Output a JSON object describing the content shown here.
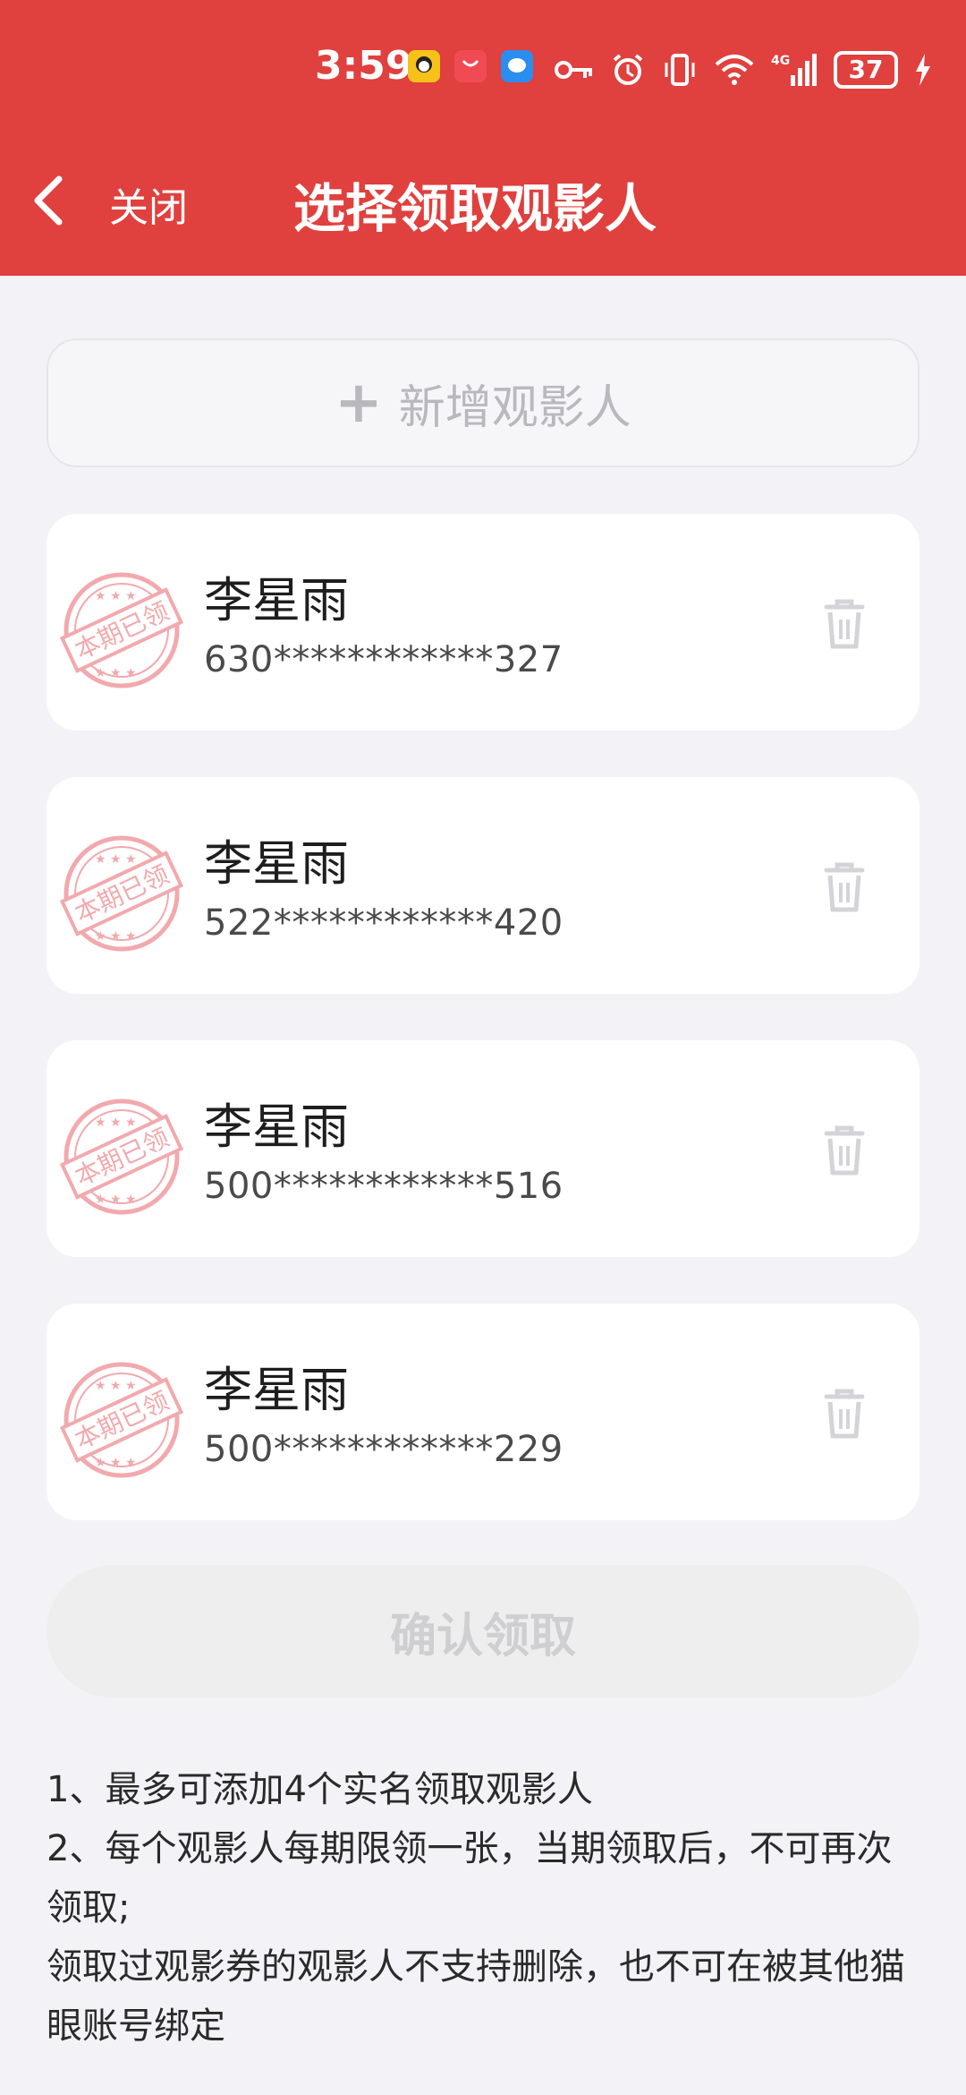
{
  "status_bar": {
    "time": "3:59",
    "battery": "37",
    "network": "4G",
    "app_icons": [
      "qq-icon",
      "huawei-appgallery-icon",
      "message-icon"
    ],
    "icons": [
      "key-icon",
      "alarm-icon",
      "vibrate-icon",
      "wifi-icon",
      "signal-icon",
      "battery-icon",
      "charging-icon"
    ]
  },
  "nav": {
    "back_icon": "chevron-left-icon",
    "close_label": "关闭",
    "title": "选择领取观影人"
  },
  "add_viewer": {
    "icon": "plus-icon",
    "label": "新增观影人"
  },
  "viewers": [
    {
      "name": "李星雨",
      "id": "630************327",
      "stamp": "本期已领"
    },
    {
      "name": "李星雨",
      "id": "522************420",
      "stamp": "本期已领"
    },
    {
      "name": "李星雨",
      "id": "500************516",
      "stamp": "本期已领"
    },
    {
      "name": "李星雨",
      "id": "500************229",
      "stamp": "本期已领"
    }
  ],
  "confirm_button": {
    "label": "确认领取",
    "enabled": false
  },
  "notes": [
    "1、最多可添加4个实名领取观影人",
    "2、每个观影人每期限领一张，当期领取后，不可再次领取;",
    "领取过观影券的观影人不支持删除，也不可在被其他猫眼账号绑定"
  ],
  "colors": {
    "header": "#e0403e",
    "background": "#f3f3f7",
    "stamp": "#f2a9ad",
    "disabled_text": "#cfcfd2"
  }
}
